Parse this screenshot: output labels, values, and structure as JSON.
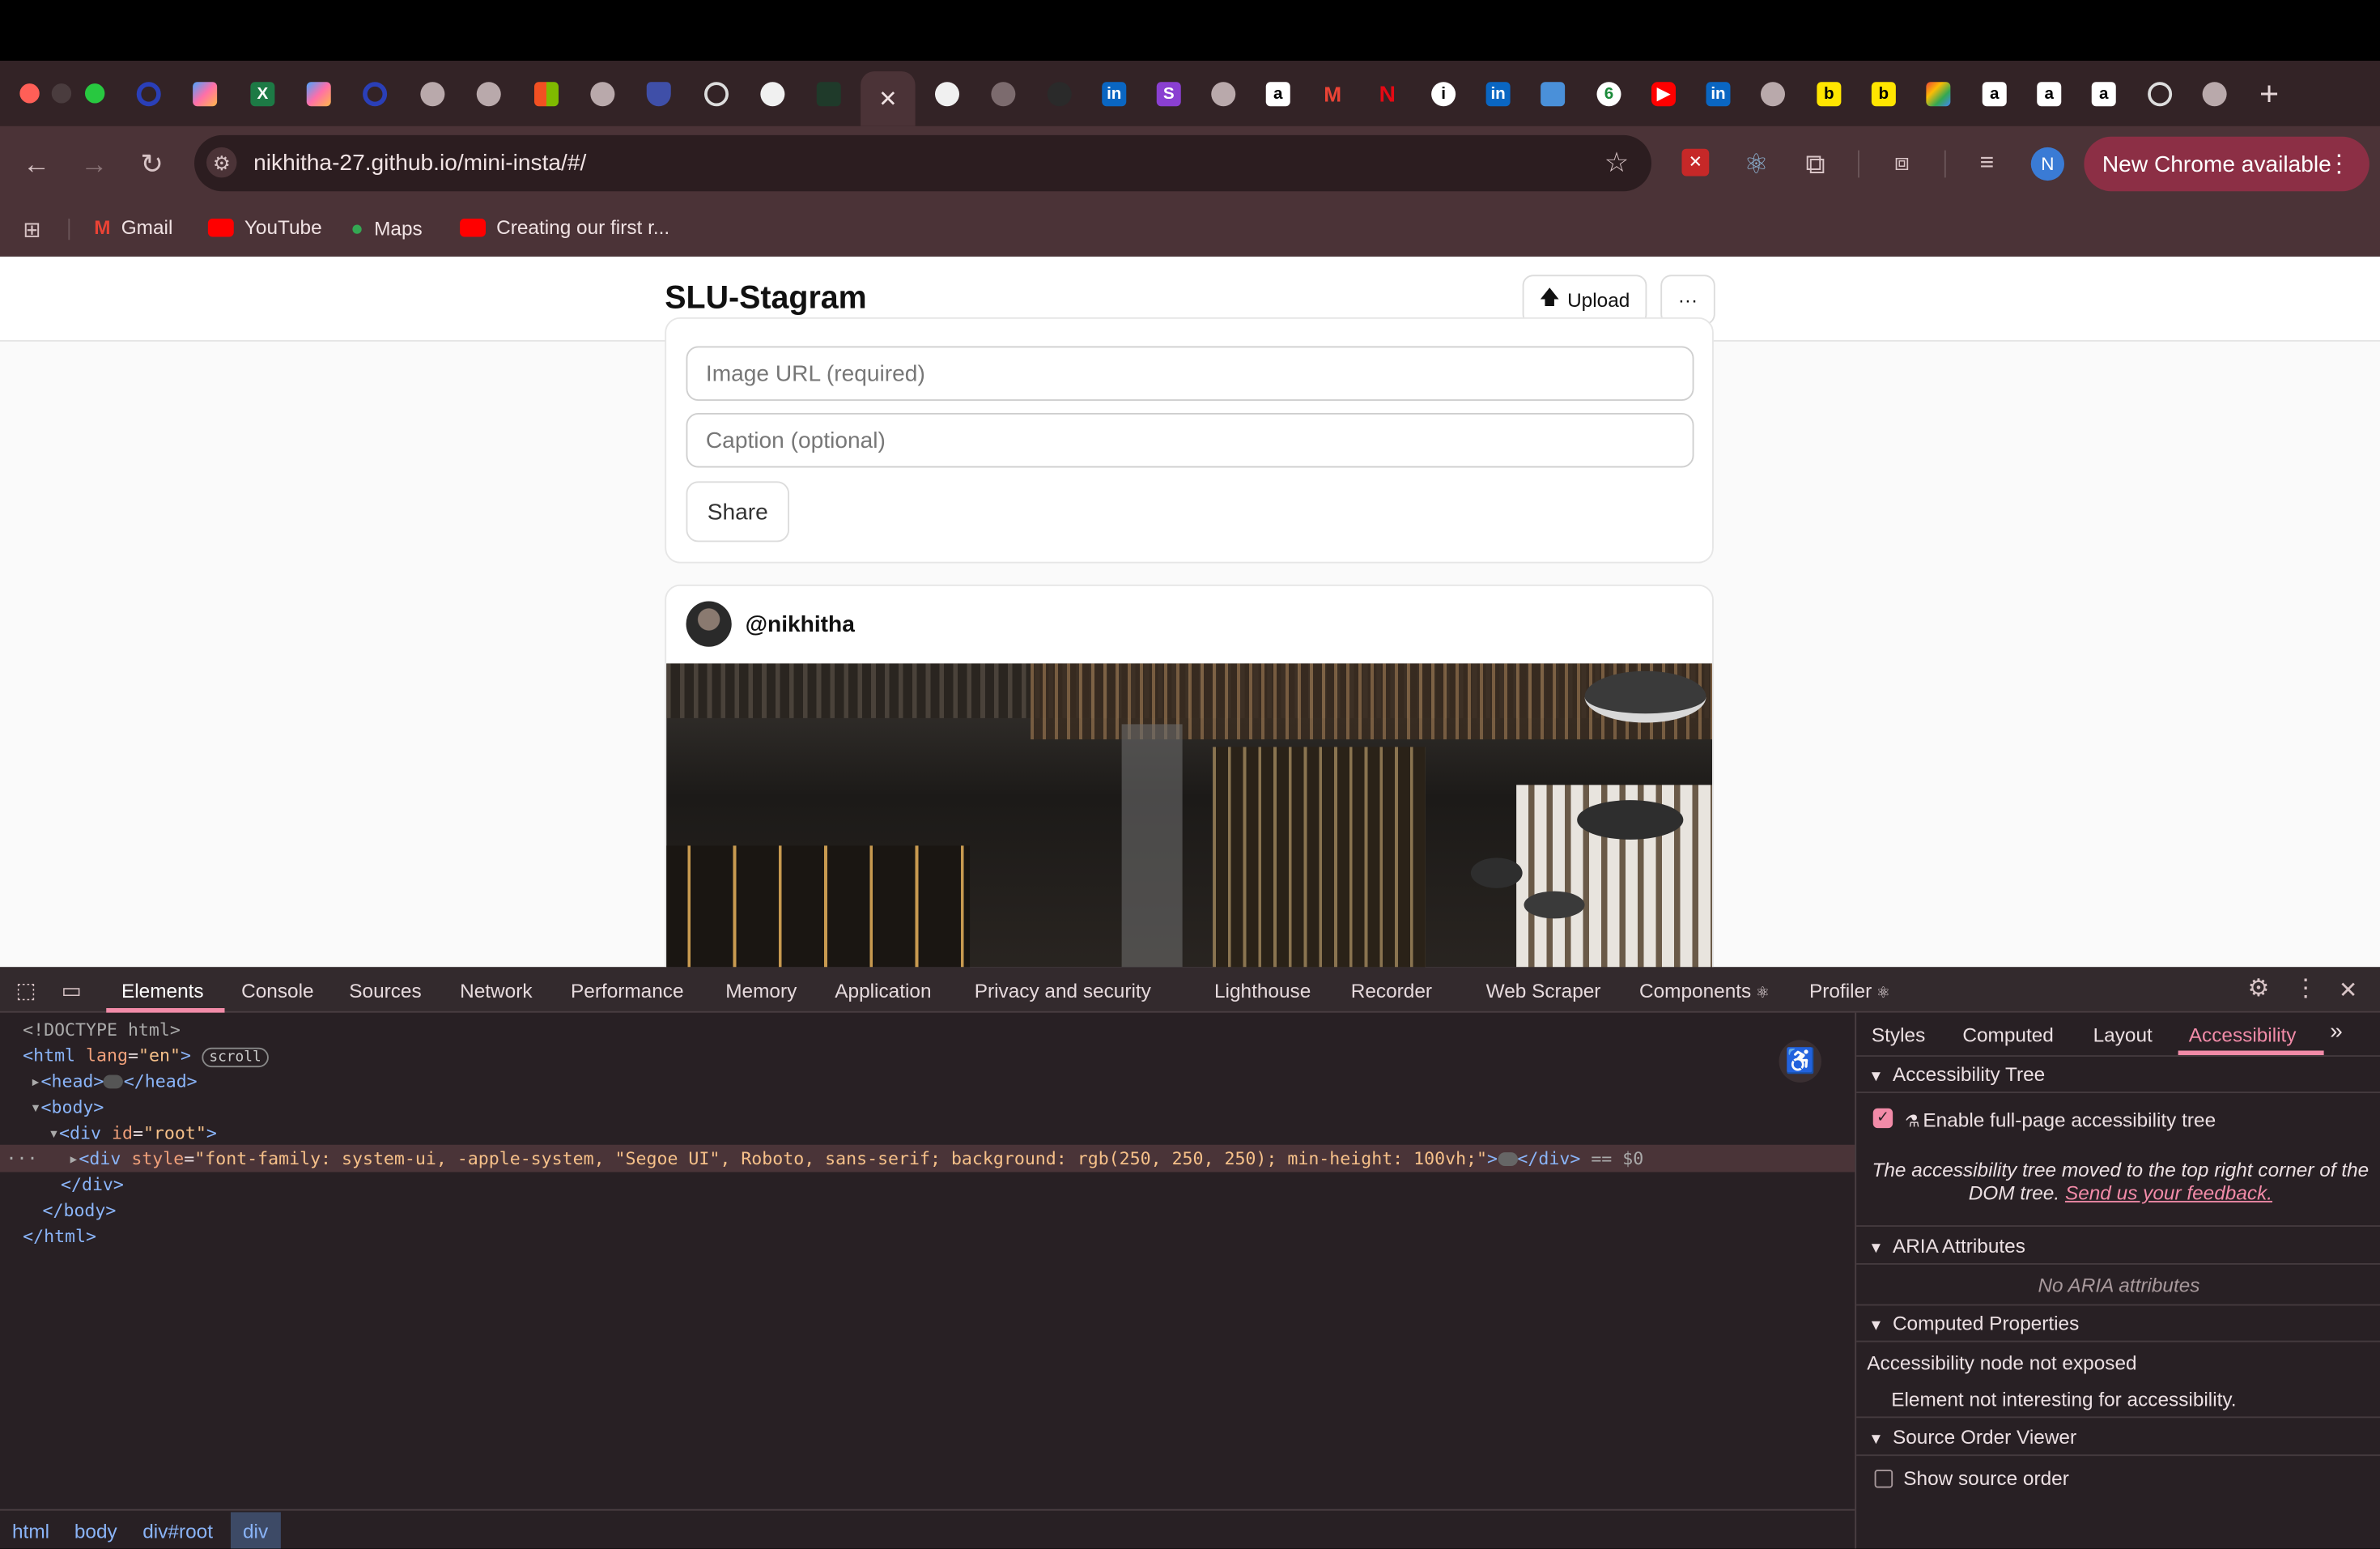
{
  "browser": {
    "url": "nikhitha-27.github.io/mini-insta/#/",
    "new_chrome_label": "New Chrome available",
    "profile_initial": "N",
    "bookmarks": [
      "Gmail",
      "YouTube",
      "Maps",
      "Creating our first r..."
    ]
  },
  "app": {
    "title": "SLU-Stagram",
    "upload_label": "Upload",
    "more_label": "···",
    "image_url_placeholder": "Image URL (required)",
    "caption_placeholder": "Caption (optional)",
    "share_label": "Share",
    "post_username": "@nikhitha"
  },
  "devtools": {
    "tabs": [
      "Elements",
      "Console",
      "Sources",
      "Network",
      "Performance",
      "Memory",
      "Application",
      "Privacy and security",
      "Lighthouse",
      "Recorder",
      "Web Scraper",
      "Components",
      "Profiler"
    ],
    "code": {
      "doctype": "<!DOCTYPE html>",
      "html_open": "<html",
      "lang_attr": "lang",
      "lang_val": "\"en\"",
      "scroll_badge": "scroll",
      "head": "<head>",
      "head_close": "</head>",
      "body_open": "<body>",
      "root_open": "<div",
      "id_attr": "id",
      "id_val": "\"root\"",
      "div_open": "<div",
      "style_attr": "style",
      "style_val": "\"font-family: system-ui, -apple-system, \"Segoe UI\", Roboto, sans-serif; background: rgb(250, 250, 250); min-height: 100vh;\"",
      "div_close": "</div>",
      "selected_marker": "== $0",
      "root_close": "</div>",
      "body_close": "</body>",
      "html_close": "</html>"
    },
    "side_tabs": [
      "Styles",
      "Computed",
      "Layout",
      "Accessibility"
    ],
    "accessibility": {
      "tree_title": "Accessibility Tree",
      "enable_label": "Enable full-page accessibility tree",
      "moved_note": "The accessibility tree moved to the top right corner of the DOM tree.",
      "feedback_link": "Send us your feedback.",
      "aria_title": "ARIA Attributes",
      "no_aria": "No ARIA attributes",
      "computed_title": "Computed Properties",
      "not_exposed": "Accessibility node not exposed",
      "not_interesting": "Element not interesting for accessibility.",
      "source_title": "Source Order Viewer",
      "show_source": "Show source order"
    },
    "breadcrumbs": [
      "html",
      "body",
      "div#root",
      "div"
    ]
  },
  "colors": {
    "tab_strip": "#332326",
    "toolbar": "#4b3337",
    "accent": "#8c2f45",
    "devtools_bg": "#282024",
    "link_blue": "#8ab4f8"
  }
}
